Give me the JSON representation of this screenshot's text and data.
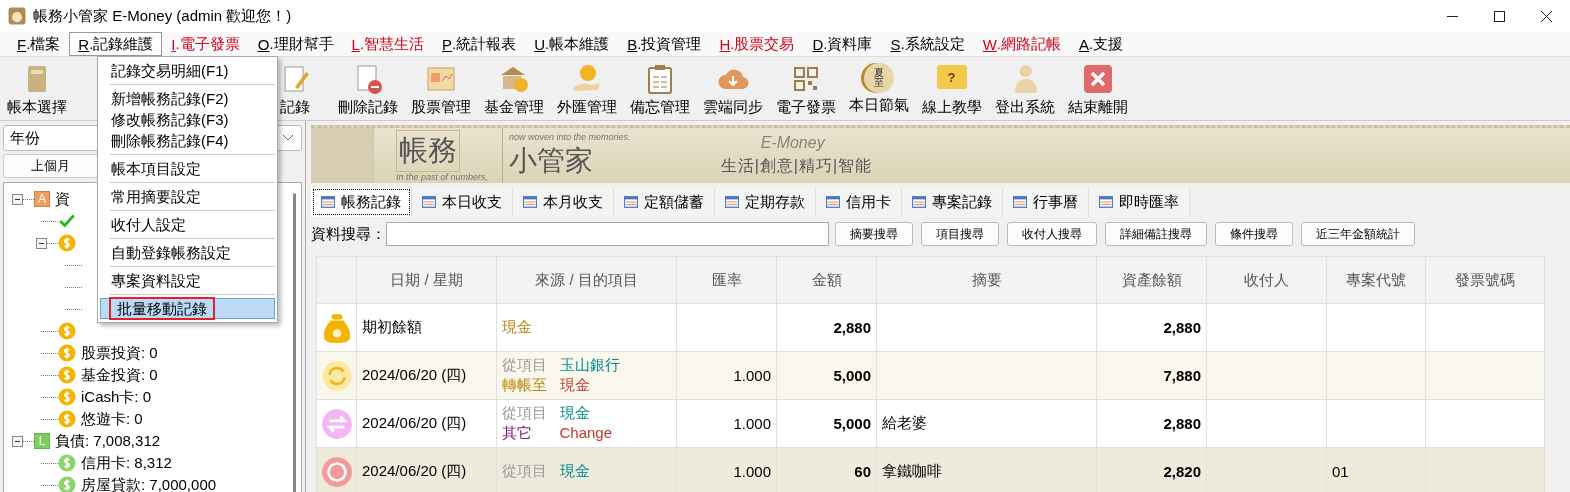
{
  "window": {
    "title": "帳務小管家 E-Money (admin 歡迎您！)"
  },
  "menu_bar": [
    {
      "mnemonic": "F",
      "label": ".檔案",
      "color": "#000000",
      "selected": false
    },
    {
      "mnemonic": "R",
      "label": ".記錄維護",
      "color": "#000000",
      "selected": true
    },
    {
      "mnemonic": "I",
      "label": ".電子發票",
      "color": "#d0021b",
      "selected": false
    },
    {
      "mnemonic": "O",
      "label": ".理財幫手",
      "color": "#000000",
      "selected": false
    },
    {
      "mnemonic": "L",
      "label": ".智慧生活",
      "color": "#d0021b",
      "selected": false
    },
    {
      "mnemonic": "P",
      "label": ".統計報表",
      "color": "#000000",
      "selected": false
    },
    {
      "mnemonic": "U",
      "label": ".帳本維護",
      "color": "#000000",
      "selected": false
    },
    {
      "mnemonic": "B",
      "label": ".投資管理",
      "color": "#000000",
      "selected": false
    },
    {
      "mnemonic": "H",
      "label": ".股票交易",
      "color": "#d0021b",
      "selected": false
    },
    {
      "mnemonic": "D",
      "label": ".資料庫",
      "color": "#000000",
      "selected": false
    },
    {
      "mnemonic": "S",
      "label": ".系統設定",
      "color": "#000000",
      "selected": false
    },
    {
      "mnemonic": "W",
      "label": ".網路記帳",
      "color": "#d0021b",
      "selected": false
    },
    {
      "mnemonic": "A",
      "label": ".支援",
      "color": "#000000",
      "selected": false
    }
  ],
  "open_menu": [
    {
      "kind": "item",
      "label": "記錄交易明細(F1)",
      "selected": false,
      "annotated": false
    },
    {
      "kind": "separator"
    },
    {
      "kind": "item",
      "label": "新增帳務記錄(F2)",
      "selected": false,
      "annotated": false
    },
    {
      "kind": "item",
      "label": "修改帳務記錄(F3)",
      "selected": false,
      "annotated": false
    },
    {
      "kind": "item",
      "label": "刪除帳務記錄(F4)",
      "selected": false,
      "annotated": false
    },
    {
      "kind": "separator"
    },
    {
      "kind": "item",
      "label": "帳本項目設定",
      "selected": false,
      "annotated": false
    },
    {
      "kind": "separator"
    },
    {
      "kind": "item",
      "label": "常用摘要設定",
      "selected": false,
      "annotated": false
    },
    {
      "kind": "separator"
    },
    {
      "kind": "item",
      "label": "收付人設定",
      "selected": false,
      "annotated": false
    },
    {
      "kind": "separator"
    },
    {
      "kind": "item",
      "label": "自動登錄帳務設定",
      "selected": false,
      "annotated": false
    },
    {
      "kind": "separator"
    },
    {
      "kind": "item",
      "label": "專案資料設定",
      "selected": false,
      "annotated": false
    },
    {
      "kind": "separator"
    },
    {
      "kind": "item",
      "label": "批量移動記錄",
      "selected": true,
      "annotated": true
    }
  ],
  "toolbar": [
    {
      "kind": "book",
      "label": "帳本選擇"
    },
    {
      "kind": "edit",
      "label": "記錄"
    },
    {
      "kind": "delete",
      "label": "刪除記錄"
    },
    {
      "kind": "stock",
      "label": "股票管理"
    },
    {
      "kind": "fund",
      "label": "基金管理"
    },
    {
      "kind": "forex",
      "label": "外匯管理"
    },
    {
      "kind": "memo",
      "label": "備忘管理"
    },
    {
      "kind": "cloud",
      "label": "雲端同步"
    },
    {
      "kind": "qr",
      "label": "電子發票"
    },
    {
      "kind": "solar",
      "label": "本日節氣",
      "icon_text": "夏至"
    },
    {
      "kind": "help",
      "label": "線上教學",
      "icon_text": "?"
    },
    {
      "kind": "person",
      "label": "登出系統"
    },
    {
      "kind": "exit",
      "label": "結束離開"
    }
  ],
  "sidebar": {
    "year_select": "年份",
    "prev_month_button": "上個月",
    "tree": [
      {
        "kind": "group",
        "badge": "A",
        "color": "#f39c5b",
        "label": "資",
        "expanded": true,
        "children": [
          {
            "kind": "check"
          },
          {
            "kind": "coin",
            "color": "#f5b400",
            "expanded": true,
            "children": [
              {
                "kind": "leaf"
              },
              {
                "kind": "leaf"
              },
              {
                "kind": "leaf"
              }
            ]
          },
          {
            "kind": "coin",
            "color": "#f5b400"
          },
          {
            "kind": "coin",
            "color": "#f5b400",
            "label": "股票投資: 0"
          },
          {
            "kind": "coin",
            "color": "#f5b400",
            "label": "基金投資: 0"
          },
          {
            "kind": "coin",
            "color": "#f5b400",
            "label": "iCash卡: 0"
          },
          {
            "kind": "coin",
            "color": "#f5b400",
            "label": "悠遊卡: 0"
          }
        ]
      },
      {
        "kind": "group",
        "badge": "L",
        "color": "#7ccf5f",
        "label": "負債: 7,008,312",
        "expanded": true,
        "children": [
          {
            "kind": "coin",
            "color": "#8bd46a",
            "label": "信用卡: 8,312"
          },
          {
            "kind": "coin",
            "color": "#8bd46a",
            "label": "房屋貸款: 7,000,000"
          }
        ]
      }
    ]
  },
  "banner": {
    "title": "帳務",
    "subtitle": "小管家",
    "tagline_1": "In the past of numbers,",
    "tagline_2": "now woven into the memories.",
    "brand": "E-Money",
    "slogan": "生活|創意|精巧|智能"
  },
  "tabs": [
    {
      "label": "帳務記錄",
      "selected": true
    },
    {
      "label": "本日收支",
      "selected": false
    },
    {
      "label": "本月收支",
      "selected": false
    },
    {
      "label": "定額儲蓄",
      "selected": false
    },
    {
      "label": "定期存款",
      "selected": false
    },
    {
      "label": "信用卡",
      "selected": false
    },
    {
      "label": "專案記錄",
      "selected": false
    },
    {
      "label": "行事曆",
      "selected": false
    },
    {
      "label": "即時匯率",
      "selected": false
    }
  ],
  "search": {
    "label": "資料搜尋：",
    "buttons": [
      "摘要搜尋",
      "項目搜尋",
      "收付人搜尋",
      "詳細備註搜尋",
      "條件搜尋",
      "近三年金額統計"
    ]
  },
  "table": {
    "columns": [
      "日期 / 星期",
      "來源 / 目的項目",
      "匯率",
      "金額",
      "摘要",
      "資產餘額",
      "收付人",
      "專案代號",
      "發票號碼"
    ],
    "rows": [
      {
        "kind": "opening",
        "selected": false,
        "date": "期初餘額",
        "lines": [
          {
            "item": {
              "text": "現金",
              "color": "#b8860b"
            }
          }
        ],
        "amount": "2,880",
        "balance": "2,880"
      },
      {
        "kind": "transfer",
        "selected": false,
        "date": "2024/06/20 (四)",
        "lines": [
          {
            "label": {
              "text": "從項目",
              "color": "#999999"
            },
            "item": {
              "text": "玉山銀行",
              "color": "#008b8b"
            }
          },
          {
            "label": {
              "text": "轉帳至",
              "color": "#b8860b"
            },
            "item": {
              "text": "現金",
              "color": "#c0392b"
            }
          }
        ],
        "rate": "1.000",
        "amount": "5,000",
        "balance": "7,880"
      },
      {
        "kind": "other",
        "selected": false,
        "date": "2024/06/20 (四)",
        "lines": [
          {
            "label": {
              "text": "從項目",
              "color": "#999999"
            },
            "item": {
              "text": "現金",
              "color": "#008b8b"
            }
          },
          {
            "label": {
              "text": "其它",
              "color": "#8b1a6b"
            },
            "item": {
              "text": "Change",
              "color": "#c0392b"
            }
          }
        ],
        "rate": "1.000",
        "amount": "5,000",
        "memo": "給老婆",
        "balance": "2,880"
      },
      {
        "kind": "expense",
        "selected": true,
        "date": "2024/06/20 (四)",
        "lines": [
          {
            "label": {
              "text": "從項目",
              "color": "#999999"
            },
            "item": {
              "text": "現金",
              "color": "#008b8b"
            }
          }
        ],
        "rate": "1.000",
        "amount": "60",
        "memo": "拿鐵咖啡",
        "balance": "2,820",
        "project": "01"
      }
    ]
  }
}
